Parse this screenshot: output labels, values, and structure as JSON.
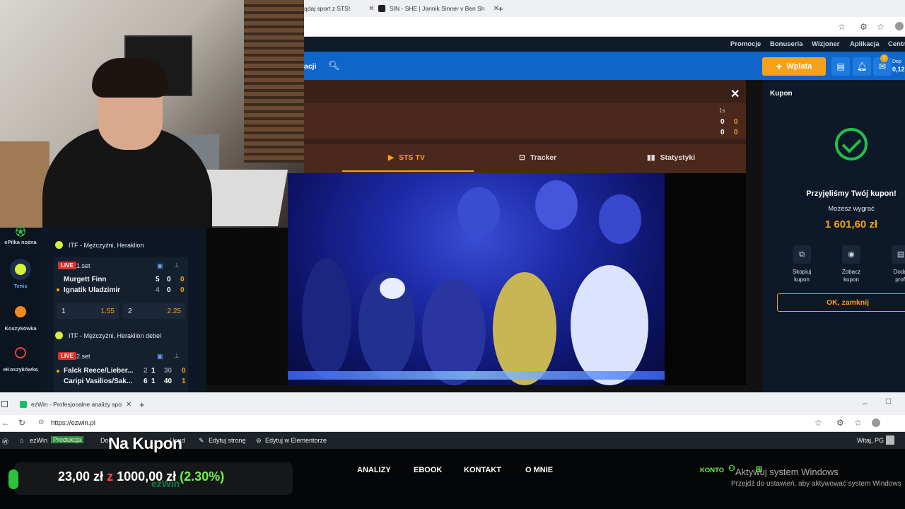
{
  "browser_top": {
    "tabs": [
      {
        "label": "ądaj sport z STS!"
      },
      {
        "label": "SIN - SHE | Jannik Sinner v Ben Sh"
      }
    ],
    "new_tab": "+"
  },
  "sts": {
    "topnav": [
      "Promocje",
      "Bonuseria",
      "Wizjoner",
      "Aplikacja",
      "Centr"
    ],
    "search_label": "acji",
    "deposit_button": "Wplata",
    "notification_count": "1",
    "deposit_label": "Dep",
    "deposit_value": "0,12"
  },
  "match": {
    "set_label": "1s",
    "scores": [
      [
        "0",
        "0"
      ],
      [
        "0",
        "0"
      ]
    ],
    "tabs": [
      "STS TV",
      "Tracker",
      "Statystyki"
    ]
  },
  "sidebar": {
    "sports": [
      "ePiłka nożna",
      "Tenis",
      "Koszykówka",
      "eKoszykówka"
    ]
  },
  "events": [
    {
      "league": "ITF - Mężczyźni, Heraklion",
      "live": "LIVE",
      "set": "1.set",
      "players": [
        {
          "name": "Murgett Finn",
          "a": "5",
          "b": "0",
          "c": "0"
        },
        {
          "name": "Ignatik Uladzimir",
          "a": "4",
          "b": "0",
          "c": "0"
        }
      ],
      "odds": [
        {
          "pick": "1",
          "value": "1.55"
        },
        {
          "pick": "2",
          "value": "2.25"
        }
      ]
    },
    {
      "league": "ITF - Mężczyźni, Heraklion debel",
      "live": "LIVE",
      "set": "2.set",
      "players": [
        {
          "name": "Falck Reece/Lieber...",
          "a": "2",
          "b": "1",
          "c": "30",
          "d": "0"
        },
        {
          "name": "Caripi Vasilios/Sak...",
          "a": "6",
          "b": "1",
          "c": "40",
          "d": "1"
        }
      ]
    }
  ],
  "coupon": {
    "title": "Kupon",
    "accepted": "Przyjęliśmy Twój kupon!",
    "can_win_label": "Możesz wygrać",
    "can_win_value": "1 601,60 zł",
    "actions": [
      {
        "label1": "Skopiuj",
        "label2": "kupon"
      },
      {
        "label1": "Zobacz",
        "label2": "kupon"
      },
      {
        "label1": "Dodaj",
        "label2": "profi"
      }
    ],
    "ok_button": "OK, zamknij"
  },
  "browser_bottom": {
    "tab_label": "ezWin - Profesjonalne analizy spo",
    "new_tab": "+",
    "url": "https://ezwin.pl"
  },
  "wp_bar": {
    "site": "ezWin",
    "env": "Produkcja",
    "dod": "Dod",
    "upd": "Uppd",
    "edit_page": "Edytuj stronę",
    "edit_elementor": "Edytuj w Elementorze",
    "greeting": "Witaj, PG"
  },
  "ezwin": {
    "nav": [
      "ANALIZY",
      "EBOOK",
      "KONTAKT",
      "O MNIE"
    ],
    "account": "KONTO",
    "logo": "ezWin"
  },
  "overlay": {
    "title": "Na Kupon",
    "stake": "23,00 zł",
    "z": "z",
    "bank": "1000,00 zł",
    "percent": "(2.30%)"
  },
  "windows_watermark": {
    "line1": "Aktywuj system Windows",
    "line2": "Przejdź do ustawień, aby aktywować system Windows"
  }
}
